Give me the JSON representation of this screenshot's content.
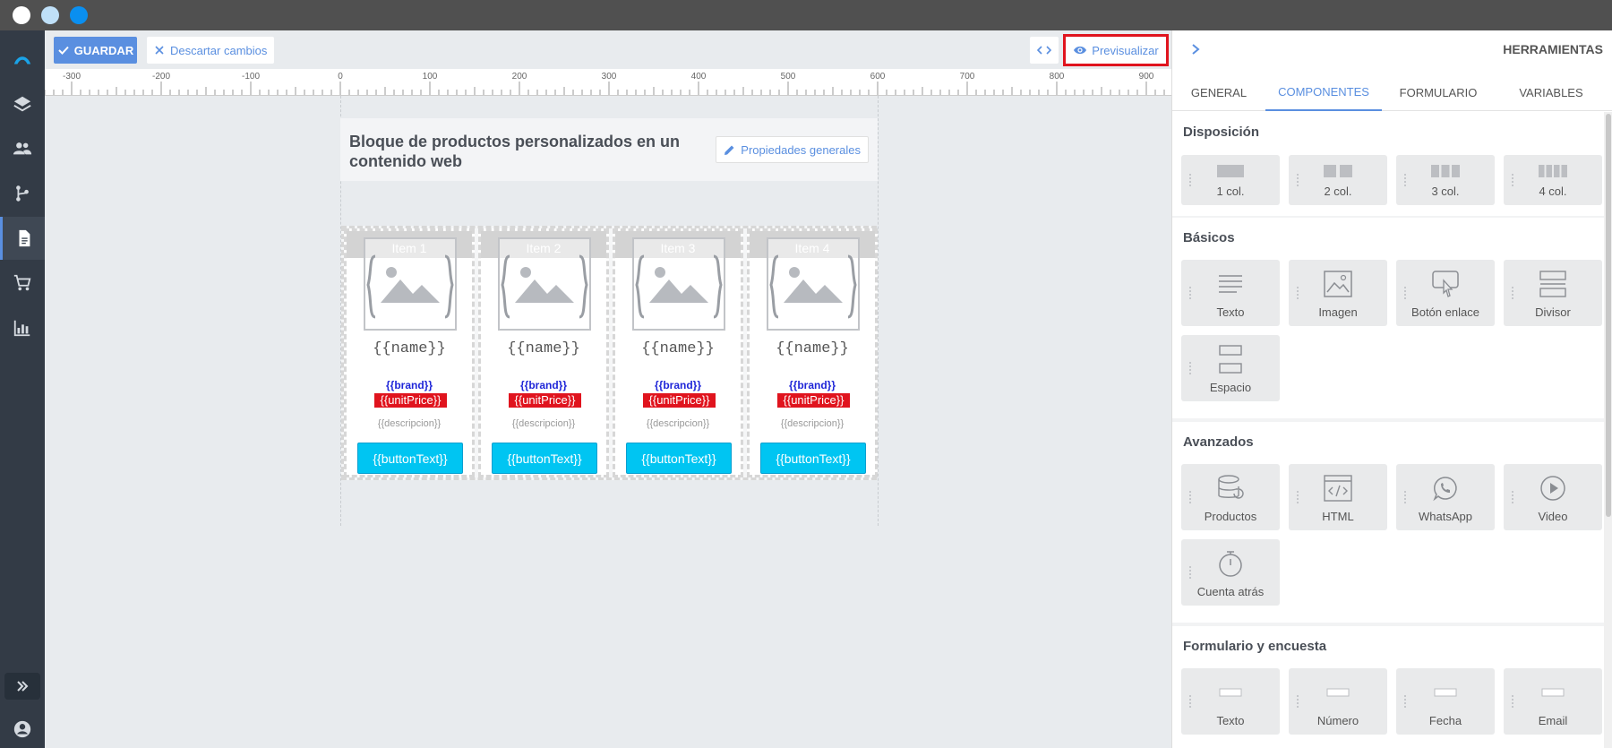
{
  "toolbar": {
    "save_label": "GUARDAR",
    "discard_label": "Descartar cambios",
    "preview_label": "Previsualizar"
  },
  "ruler": {
    "ticks": [
      "-300",
      "-200",
      "-100",
      "0",
      "100",
      "200",
      "300",
      "400",
      "500",
      "600",
      "700",
      "800",
      "900"
    ]
  },
  "block": {
    "title": "Bloque de productos personalizados en un contenido web",
    "props_label": "Propiedades generales"
  },
  "items": [
    {
      "label": "Item 1",
      "name": "{{name}}",
      "brand": "{{brand}}",
      "price": "{{unitPrice}}",
      "desc": "{{descripcion}}",
      "button": "{{buttonText}}"
    },
    {
      "label": "Item 2",
      "name": "{{name}}",
      "brand": "{{brand}}",
      "price": "{{unitPrice}}",
      "desc": "{{descripcion}}",
      "button": "{{buttonText}}"
    },
    {
      "label": "Item 3",
      "name": "{{name}}",
      "brand": "{{brand}}",
      "price": "{{unitPrice}}",
      "desc": "{{descripcion}}",
      "button": "{{buttonText}}"
    },
    {
      "label": "Item 4",
      "name": "{{name}}",
      "brand": "{{brand}}",
      "price": "{{unitPrice}}",
      "desc": "{{descripcion}}",
      "button": "{{buttonText}}"
    }
  ],
  "panel": {
    "title": "HERRAMIENTAS",
    "tabs": [
      "GENERAL",
      "COMPONENTES",
      "FORMULARIO",
      "VARIABLES"
    ],
    "active_tab": "COMPONENTES",
    "sections": {
      "disposicion": {
        "title": "Disposición",
        "tiles": [
          "1 col.",
          "2 col.",
          "3 col.",
          "4 col."
        ]
      },
      "basicos": {
        "title": "Básicos",
        "tiles": [
          "Texto",
          "Imagen",
          "Botón enlace",
          "Divisor",
          "Espacio"
        ]
      },
      "avanzados": {
        "title": "Avanzados",
        "tiles": [
          "Productos",
          "HTML",
          "WhatsApp",
          "Video",
          "Cuenta atrás"
        ]
      },
      "formulario": {
        "title": "Formulario y encuesta",
        "tiles": [
          "Texto",
          "Número",
          "Fecha",
          "Email"
        ]
      }
    }
  },
  "colors": {
    "accent": "#5a8fe0",
    "sidebar": "#333b46",
    "price_bg": "#e0141e",
    "brand_text": "#1f26d8",
    "item_button": "#00c5f2",
    "highlight_border": "#e0141e"
  },
  "icons": {
    "nav": [
      "logo-icon",
      "layers-icon",
      "users-icon",
      "flow-icon",
      "document-icon",
      "cart-icon",
      "chart-icon"
    ],
    "bottom": [
      "expand-icon",
      "account-icon"
    ]
  }
}
